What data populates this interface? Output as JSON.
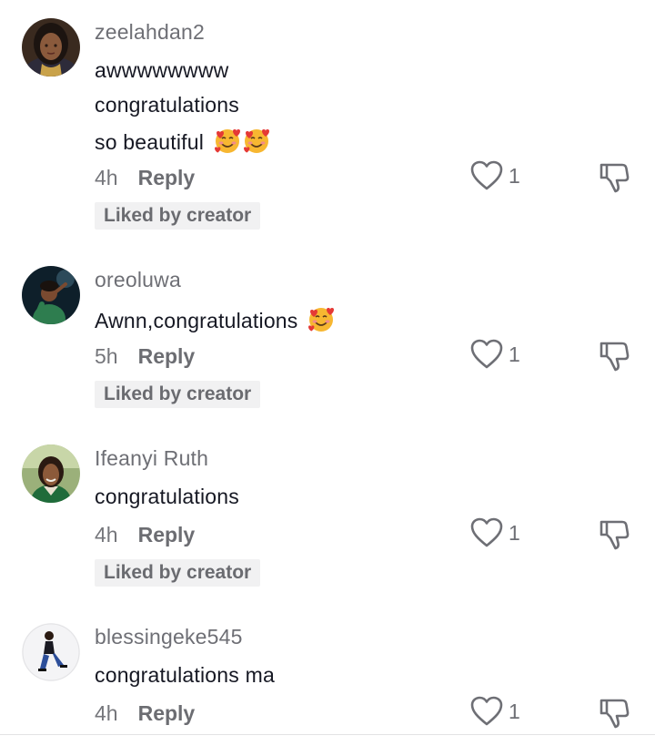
{
  "comments": [
    {
      "username": "zeelahdan2",
      "lines": [
        "awwwwwwww",
        "congratulations",
        "so beautiful"
      ],
      "emoji": [
        "smiling-face-with-hearts",
        "smiling-face-with-hearts"
      ],
      "time": "4h",
      "reply_label": "Reply",
      "likes": "1",
      "badge": "Liked by creator"
    },
    {
      "username": "oreoluwa",
      "lines": [
        "Awnn,congratulations"
      ],
      "emoji": [
        "smiling-face-with-hearts"
      ],
      "time": "5h",
      "reply_label": "Reply",
      "likes": "1",
      "badge": "Liked by creator"
    },
    {
      "username": "Ifeanyi Ruth",
      "lines": [
        "congratulations"
      ],
      "emoji": [],
      "time": "4h",
      "reply_label": "Reply",
      "likes": "1",
      "badge": "Liked by creator"
    },
    {
      "username": "blessingeke545",
      "lines": [
        "congratulations ma"
      ],
      "emoji": [],
      "time": "4h",
      "reply_label": "Reply",
      "likes": "1",
      "badge": ""
    }
  ],
  "icons": {
    "like": "heart-outline-icon",
    "dislike": "thumbs-down-outline-icon"
  },
  "colors": {
    "primary_text": "#161823",
    "secondary_text": "#6e6f75",
    "badge_bg": "#f1f1f2"
  }
}
